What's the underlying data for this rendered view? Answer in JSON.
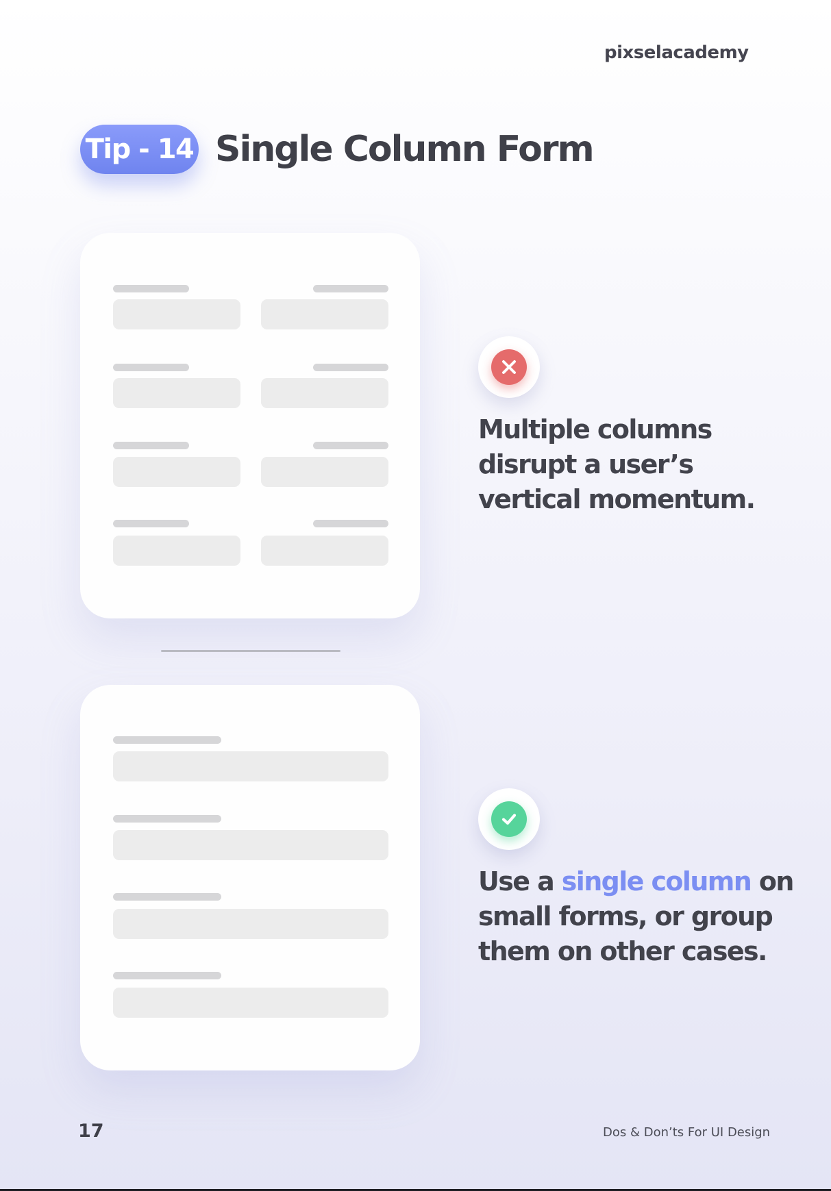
{
  "header": {
    "brand": "pixselacademy"
  },
  "tip": {
    "badge": "Tip - 14",
    "title": "Single Column Form"
  },
  "dont": {
    "icon": "close-icon",
    "text": "Multiple columns disrupt a user’s vertical momentum."
  },
  "do": {
    "icon": "check-icon",
    "text_before": "Use a ",
    "text_highlight": "single column",
    "text_after": " on small forms, or group them on other cases."
  },
  "colors": {
    "accent": "#7b8ef2",
    "error": "#e56b6b",
    "success": "#56d49b",
    "text": "#3f4049"
  },
  "footer": {
    "page_number": "17",
    "document_title": "Dos & Don’ts For UI Design"
  }
}
